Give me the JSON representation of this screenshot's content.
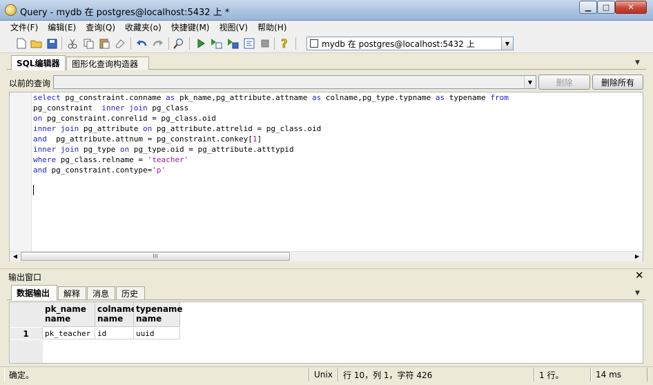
{
  "window": {
    "title": "Query - mydb 在  postgres@localhost:5432 上 *",
    "controls": {
      "minimize": "▁",
      "maximize": "□",
      "close": "✕"
    }
  },
  "menu": [
    "文件(F)",
    "编辑(E)",
    "查询(Q)",
    "收藏夹(o)",
    "快捷键(M)",
    "视图(V)",
    "帮助(H)"
  ],
  "toolbar": {
    "icons": [
      "new-file-icon",
      "open-folder-icon",
      "save-icon",
      "cut-icon",
      "copy-icon",
      "paste-icon",
      "clear-icon",
      "undo-icon",
      "redo-icon",
      "find-icon",
      "execute-icon",
      "execute-explain-icon",
      "execute-to-file-icon",
      "explain-icon",
      "stop-icon",
      "help-icon"
    ],
    "connection": "mydb 在  postgres@localhost:5432 上"
  },
  "editor_tabs": [
    "SQL编辑器",
    "图形化查询构造器"
  ],
  "history": {
    "label": "以前的查询",
    "delete_label": "删除",
    "delete_all_label": "删除所有"
  },
  "sql_lines": [
    [
      {
        "t": "select",
        "c": "kw"
      },
      {
        "t": " pg_constraint.conname "
      },
      {
        "t": "as",
        "c": "kw"
      },
      {
        "t": " pk_name,pg_attribute.attname "
      },
      {
        "t": "as",
        "c": "kw"
      },
      {
        "t": " colname,pg_type.typname "
      },
      {
        "t": "as",
        "c": "kw"
      },
      {
        "t": " typename "
      },
      {
        "t": "from",
        "c": "kw"
      }
    ],
    [
      {
        "t": "pg_constraint  "
      },
      {
        "t": "inner",
        "c": "kw"
      },
      {
        "t": " "
      },
      {
        "t": "join",
        "c": "kw"
      },
      {
        "t": " pg_class"
      }
    ],
    [
      {
        "t": "on",
        "c": "kw"
      },
      {
        "t": " pg_constraint.conrelid = pg_class.oid"
      }
    ],
    [
      {
        "t": "inner",
        "c": "kw"
      },
      {
        "t": " "
      },
      {
        "t": "join",
        "c": "kw"
      },
      {
        "t": " pg_attribute "
      },
      {
        "t": "on",
        "c": "kw"
      },
      {
        "t": " pg_attribute.attrelid = pg_class.oid"
      }
    ],
    [
      {
        "t": "and",
        "c": "kw"
      },
      {
        "t": "  pg_attribute.attnum = pg_constraint.conkey["
      },
      {
        "t": "1",
        "c": "num"
      },
      {
        "t": "]"
      }
    ],
    [
      {
        "t": "inner",
        "c": "kw"
      },
      {
        "t": " "
      },
      {
        "t": "join",
        "c": "kw"
      },
      {
        "t": " pg_type "
      },
      {
        "t": "on",
        "c": "kw"
      },
      {
        "t": " pg_type.oid = pg_attribute.atttypid"
      }
    ],
    [
      {
        "t": "where",
        "c": "kw"
      },
      {
        "t": " pg_class.relname = "
      },
      {
        "t": "'teacher'",
        "c": "str"
      }
    ],
    [
      {
        "t": "and",
        "c": "kw"
      },
      {
        "t": " pg_constraint.contype="
      },
      {
        "t": "'p'",
        "c": "str"
      }
    ]
  ],
  "scrollbar_grip": "III",
  "output": {
    "title": "输出窗口",
    "close": "✕",
    "tabs": [
      "数据输出",
      "解释",
      "消息",
      "历史"
    ]
  },
  "grid": {
    "columns": [
      {
        "name": "pk_name",
        "type": "name"
      },
      {
        "name": "colname",
        "type": "name"
      },
      {
        "name": "typename",
        "type": "name"
      }
    ],
    "rows": [
      {
        "num": "1",
        "cells": [
          "pk_teacher",
          "id",
          "uuid"
        ]
      }
    ]
  },
  "status": {
    "message": "确定。",
    "line_endings": "Unix",
    "position": "行 10，列 1，字符 426",
    "rows": "1 行。",
    "time": "14 ms"
  },
  "colors": {
    "keyword": "#1f1fc8",
    "string": "#9b1e9b"
  }
}
